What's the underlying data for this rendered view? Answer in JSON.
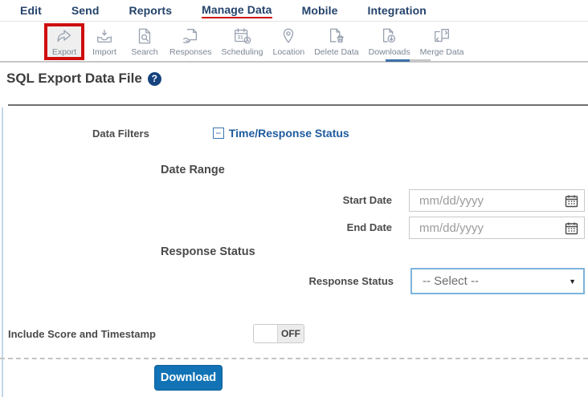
{
  "nav": {
    "items": [
      {
        "label": "Edit"
      },
      {
        "label": "Send"
      },
      {
        "label": "Reports"
      },
      {
        "label": "Manage Data",
        "active": true
      },
      {
        "label": "Mobile"
      },
      {
        "label": "Integration"
      }
    ]
  },
  "toolbar": {
    "items": [
      {
        "label": "Export",
        "icon": "export-icon",
        "highlighted": true
      },
      {
        "label": "Import",
        "icon": "import-icon"
      },
      {
        "label": "Search",
        "icon": "search-icon"
      },
      {
        "label": "Responses",
        "icon": "responses-icon"
      },
      {
        "label": "Scheduling",
        "icon": "scheduling-icon",
        "icon_text": "31"
      },
      {
        "label": "Location",
        "icon": "location-icon"
      },
      {
        "label": "Delete Data",
        "icon": "delete-data-icon"
      },
      {
        "label": "Downloads",
        "icon": "downloads-icon"
      },
      {
        "label": "Merge Data",
        "icon": "merge-data-icon"
      }
    ]
  },
  "page": {
    "title": "SQL Export Data File",
    "help_glyph": "?"
  },
  "form": {
    "data_filters_label": "Data Filters",
    "filter_group": {
      "collapse_glyph": "−",
      "label": "Time/Response Status"
    },
    "date_range_heading": "Date Range",
    "start_date": {
      "label": "Start Date",
      "placeholder": "mm/dd/yyyy",
      "value": ""
    },
    "end_date": {
      "label": "End Date",
      "placeholder": "mm/dd/yyyy",
      "value": ""
    },
    "response_status_heading": "Response Status",
    "response_status": {
      "label": "Response Status",
      "selected": "-- Select --",
      "arrow": "▼"
    },
    "include_score": {
      "label": "Include Score and Timestamp",
      "state": "OFF"
    },
    "download_label": "Download"
  },
  "colors": {
    "accent_blue": "#1173b5",
    "link_blue": "#1e5b9e",
    "nav_blue": "#24436b",
    "highlight_red": "#cf0d0d"
  }
}
